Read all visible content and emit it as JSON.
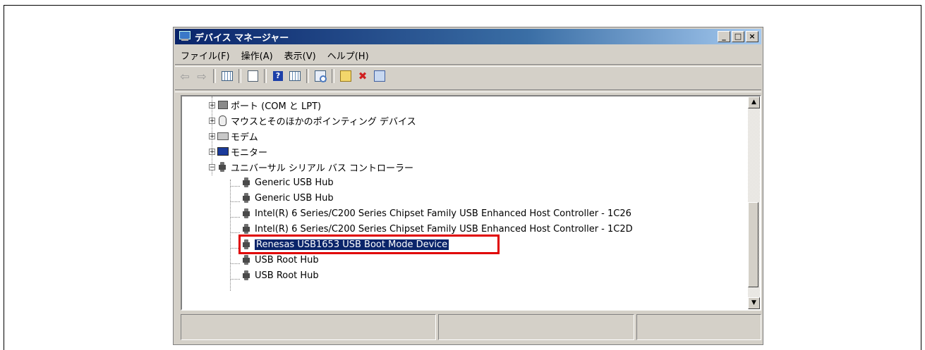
{
  "window": {
    "title": "デバイス マネージャー",
    "controls": [
      "_",
      "□",
      "×"
    ]
  },
  "menu": [
    {
      "label": "ファイル(F)"
    },
    {
      "label": "操作(A)"
    },
    {
      "label": "表示(V)"
    },
    {
      "label": "ヘルプ(H)"
    }
  ],
  "toolbar": [
    "back-icon",
    "forward-icon",
    "show-hide-console-tree-icon",
    "properties-icon",
    "help-icon",
    "action-pane-icon",
    "scan-hardware-icon",
    "update-driver-icon",
    "uninstall-icon",
    "install-icon"
  ],
  "tree": {
    "categories": [
      {
        "label": "ポート (COM と LPT)",
        "expanded": false,
        "icon": "port-icon"
      },
      {
        "label": "マウスとそのほかのポインティング デバイス",
        "expanded": false,
        "icon": "mouse-icon"
      },
      {
        "label": "モデム",
        "expanded": false,
        "icon": "modem-icon"
      },
      {
        "label": "モニター",
        "expanded": false,
        "icon": "monitor-icon"
      },
      {
        "label": "ユニバーサル シリアル バス コントローラー",
        "expanded": true,
        "icon": "usb-icon"
      }
    ],
    "usb_devices": [
      {
        "label": "Generic USB Hub"
      },
      {
        "label": "Generic USB Hub"
      },
      {
        "label": "Intel(R) 6 Series/C200 Series Chipset Family USB Enhanced Host Controller - 1C26"
      },
      {
        "label": "Intel(R) 6 Series/C200 Series Chipset Family USB Enhanced Host Controller - 1C2D"
      },
      {
        "label": "Renesas USB1653 USB Boot Mode Device",
        "selected": true
      },
      {
        "label": "USB Root Hub"
      },
      {
        "label": "USB Root Hub"
      }
    ]
  },
  "colors": {
    "selection": "#0a246a",
    "highlight_box": "#e00000",
    "titlebar": "#0a246a"
  }
}
